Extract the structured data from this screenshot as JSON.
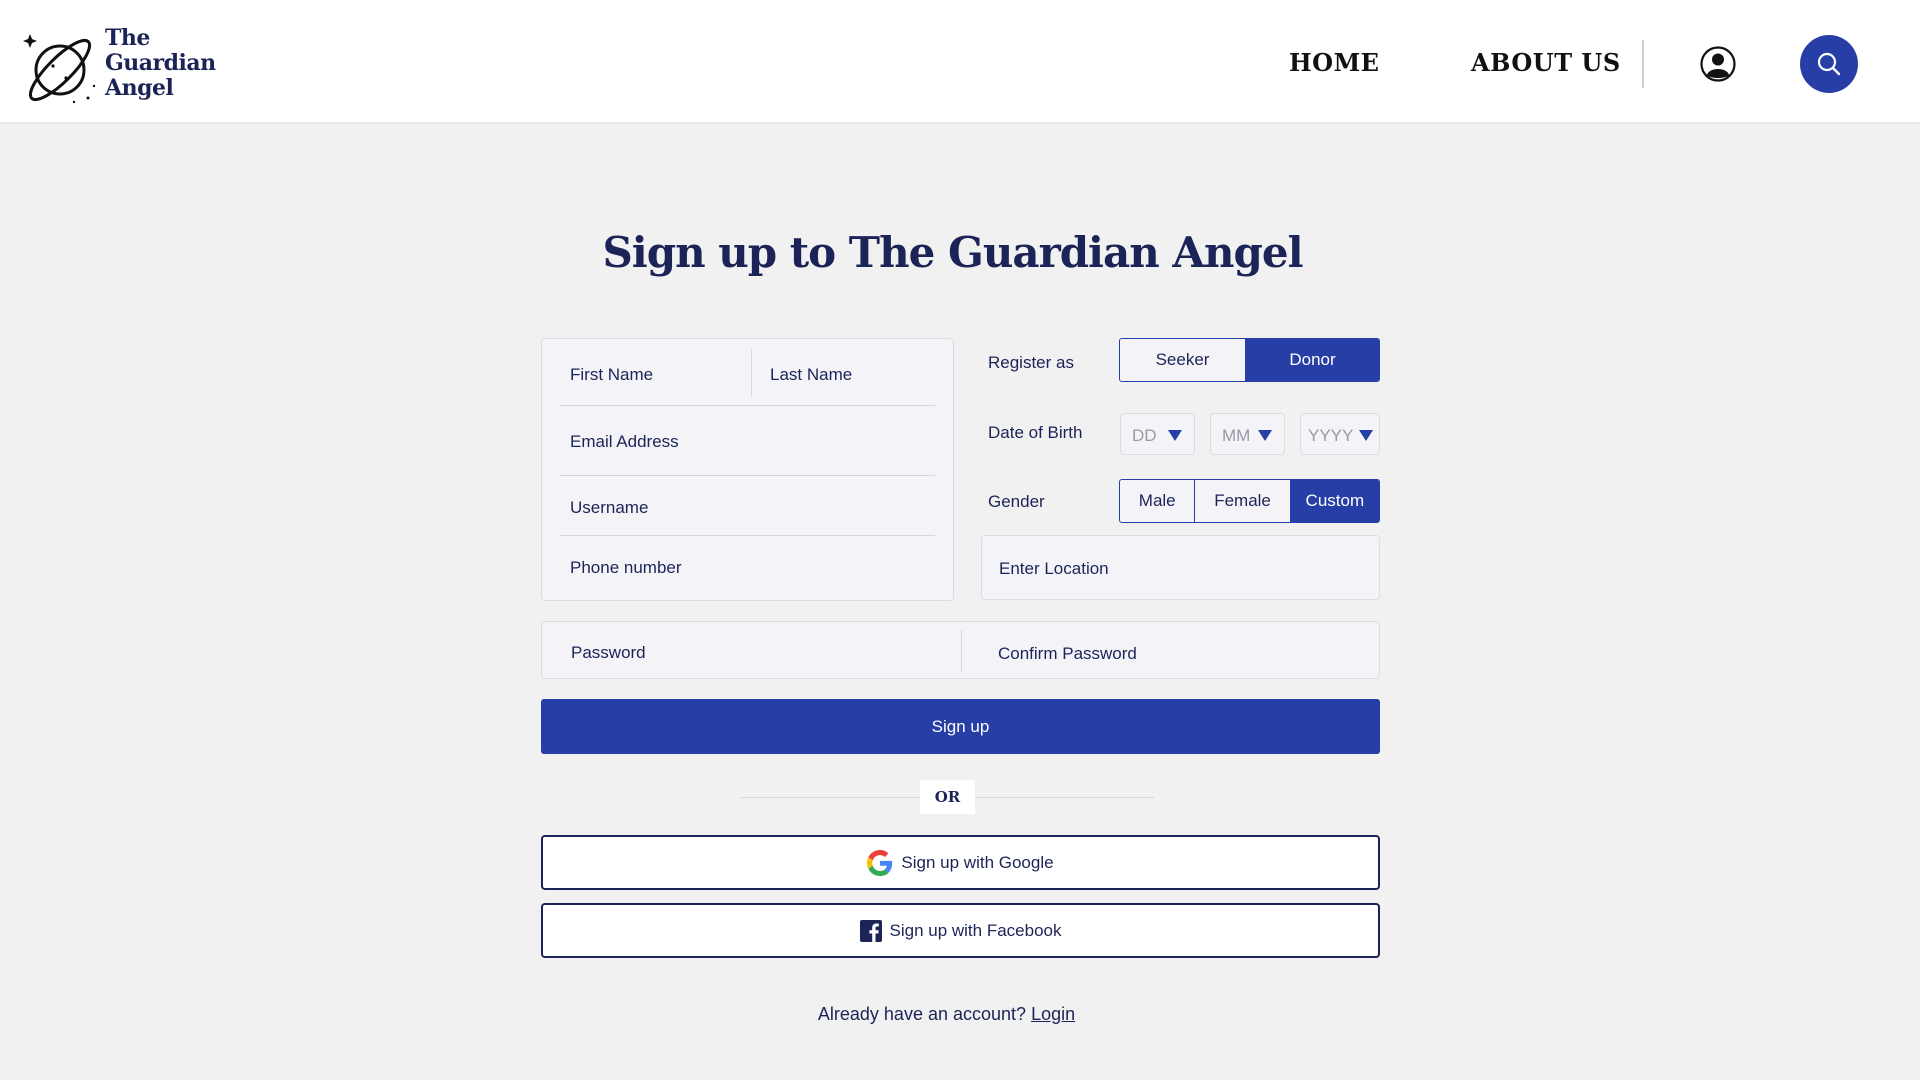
{
  "header": {
    "logo_lines": [
      "The",
      "Guardian",
      "Angel"
    ],
    "nav": [
      {
        "label": "HOME"
      },
      {
        "label": "ABOUT US"
      }
    ],
    "icons": {
      "user": "user-icon",
      "search": "search-icon"
    },
    "accent_color": "#273ea6"
  },
  "page": {
    "title": "Sign up to The Guardian Angel"
  },
  "form": {
    "first_name": "First Name",
    "last_name": "Last Name",
    "email": "Email Address",
    "username": "Username",
    "phone": "Phone number",
    "register_as": {
      "label": "Register as",
      "options": [
        "Seeker",
        "Donor"
      ],
      "selected": "Donor"
    },
    "dob": {
      "label": "Date of Birth",
      "day": "DD",
      "month": "MM",
      "year": "YYYY"
    },
    "gender": {
      "label": "Gender",
      "options": [
        "Male",
        "Female",
        "Custom"
      ],
      "selected": "Custom"
    },
    "location": "Enter Location",
    "password": "Password",
    "confirm_password": "Confirm Password",
    "signup_label": "Sign up",
    "or_label": "OR",
    "google_label": "Sign up with Google",
    "facebook_label": "Sign up with Facebook",
    "login_prompt": "Already have an account?",
    "login_label": "Login"
  }
}
